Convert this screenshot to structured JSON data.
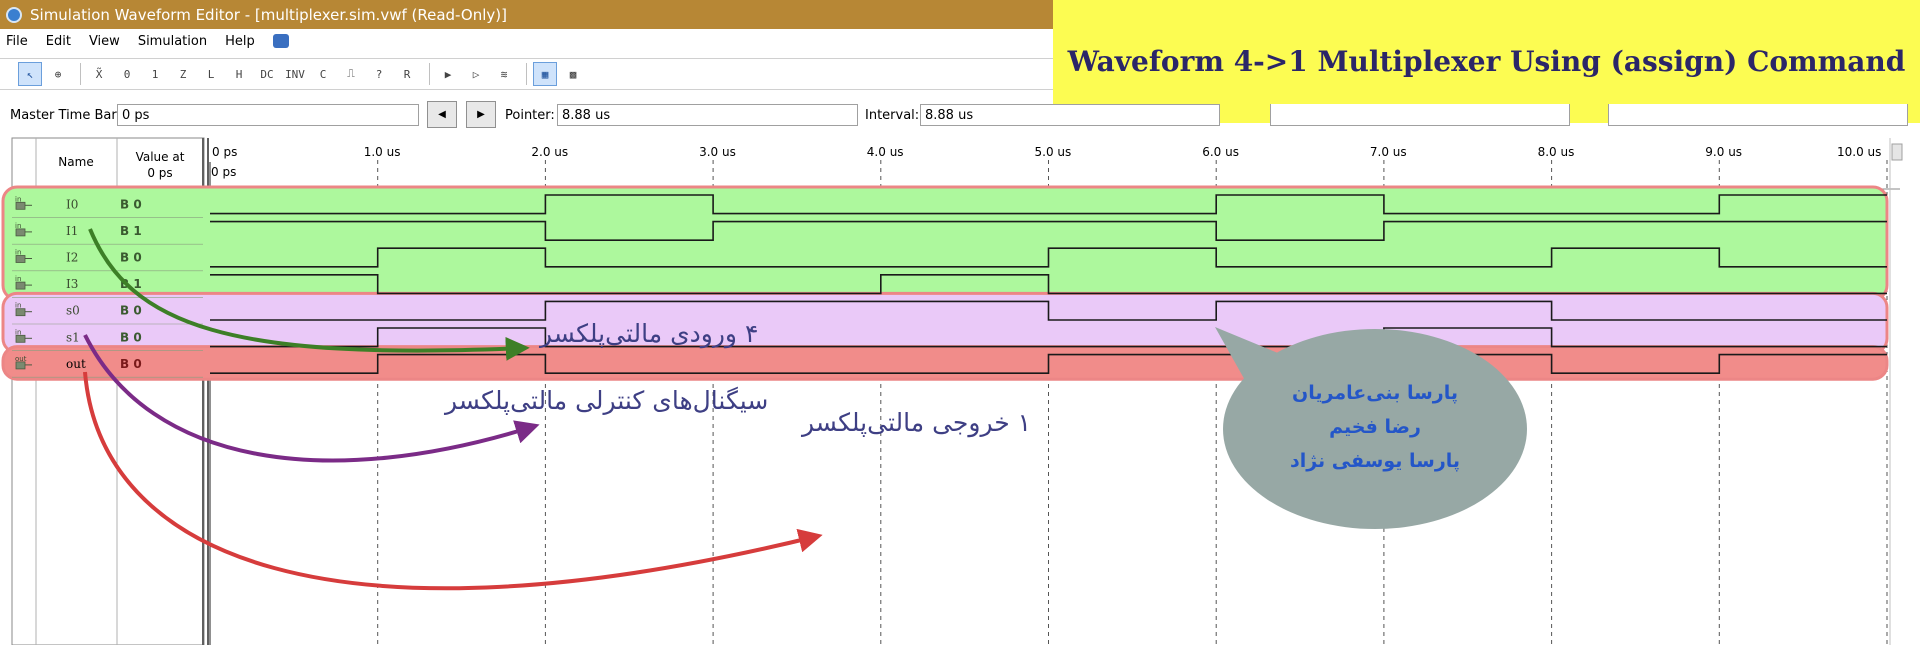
{
  "window": {
    "title": "Simulation Waveform Editor - [multiplexer.sim.vwf (Read-Only)]"
  },
  "banner": {
    "text": "Waveform 4->1 Multiplexer Using (assign) Command"
  },
  "menu": [
    "File",
    "Edit",
    "View",
    "Simulation",
    "Help"
  ],
  "toolbar": {
    "tools": [
      {
        "name": "selection-tool-icon",
        "glyph": "↖",
        "active": true
      },
      {
        "name": "zoom-tool-icon",
        "glyph": "⊕"
      },
      {
        "name": "forcing-unknown-icon",
        "glyph": "X̃"
      },
      {
        "name": "forcing-low-icon",
        "glyph": "0"
      },
      {
        "name": "forcing-high-icon",
        "glyph": "1"
      },
      {
        "name": "high-impedance-icon",
        "glyph": "Z"
      },
      {
        "name": "weak-low-icon",
        "glyph": "L"
      },
      {
        "name": "weak-high-icon",
        "glyph": "H"
      },
      {
        "name": "dont-care-icon",
        "glyph": "DC"
      },
      {
        "name": "invert-icon",
        "glyph": "INV"
      },
      {
        "name": "count-value-icon",
        "glyph": "C"
      },
      {
        "name": "clock-icon",
        "glyph": "⎍"
      },
      {
        "name": "arbitrary-value-icon",
        "glyph": "?"
      },
      {
        "name": "random-value-icon",
        "glyph": "R"
      },
      {
        "name": "functional-sim-icon",
        "glyph": "▶"
      },
      {
        "name": "timing-sim-icon",
        "glyph": "▷"
      },
      {
        "name": "netlist-icon",
        "glyph": "≋"
      },
      {
        "name": "snap-to-grid-icon",
        "glyph": "▦",
        "active": true
      },
      {
        "name": "grid-options-icon",
        "glyph": "▩"
      }
    ]
  },
  "timebar": {
    "master_label": "Master Time Bar:",
    "master_value": "0 ps",
    "pointer_label": "Pointer:",
    "pointer_value": "8.88 us",
    "interval_label": "Interval:",
    "interval_value": "8.88 us",
    "prev_glyph": "◀",
    "next_glyph": "▶"
  },
  "grid": {
    "name_header": "Name",
    "value_header": "Value at\n0 ps",
    "ruler_ticks": [
      "0 ps",
      "1.0 us",
      "2.0 us",
      "3.0 us",
      "4.0 us",
      "5.0 us",
      "6.0 us",
      "7.0 us",
      "8.0 us",
      "9.0 us",
      "10.0 us"
    ],
    "cursor_label": "0 ps",
    "signals": [
      {
        "name": "I0",
        "value": "B 0",
        "kind": "in",
        "group": "inputs",
        "segments": [
          [
            0,
            2,
            0
          ],
          [
            2,
            3,
            1
          ],
          [
            3,
            6,
            0
          ],
          [
            6,
            7,
            1
          ],
          [
            7,
            8,
            0
          ],
          [
            8,
            9,
            0
          ],
          [
            9,
            10,
            1
          ]
        ]
      },
      {
        "name": "I1",
        "value": "B 1",
        "kind": "in",
        "group": "inputs",
        "segments": [
          [
            0,
            2,
            1
          ],
          [
            2,
            3,
            0
          ],
          [
            3,
            5,
            1
          ],
          [
            5,
            6,
            1
          ],
          [
            6,
            7,
            0
          ],
          [
            7,
            8,
            1
          ],
          [
            8,
            9,
            1
          ],
          [
            9,
            10,
            1
          ]
        ]
      },
      {
        "name": "I2",
        "value": "B 0",
        "kind": "in",
        "group": "inputs",
        "segments": [
          [
            0,
            1,
            0
          ],
          [
            1,
            2,
            1
          ],
          [
            2,
            5,
            0
          ],
          [
            5,
            6,
            1
          ],
          [
            6,
            8,
            0
          ],
          [
            8,
            9,
            1
          ],
          [
            9,
            10,
            0
          ]
        ]
      },
      {
        "name": "I3",
        "value": "B 1",
        "kind": "in",
        "group": "inputs",
        "segments": [
          [
            0,
            1,
            1
          ],
          [
            1,
            4,
            0
          ],
          [
            4,
            5,
            1
          ],
          [
            5,
            10,
            0
          ]
        ]
      },
      {
        "name": "s0",
        "value": "B 0",
        "kind": "in",
        "group": "selects",
        "segments": [
          [
            0,
            2,
            0
          ],
          [
            2,
            5,
            1
          ],
          [
            5,
            6,
            0
          ],
          [
            6,
            8,
            1
          ],
          [
            8,
            10,
            0
          ]
        ]
      },
      {
        "name": "s1",
        "value": "B 0",
        "kind": "in",
        "group": "selects",
        "segments": [
          [
            0,
            1,
            0
          ],
          [
            1,
            2,
            1
          ],
          [
            2,
            7,
            0
          ],
          [
            7,
            8,
            1
          ],
          [
            8,
            10,
            0
          ]
        ]
      },
      {
        "name": "out",
        "value": "B 0",
        "kind": "out",
        "group": "output",
        "segments": [
          [
            0,
            1,
            0
          ],
          [
            1,
            2,
            1
          ],
          [
            2,
            5,
            0
          ],
          [
            5,
            8,
            1
          ],
          [
            8,
            9,
            0
          ],
          [
            9,
            10,
            1
          ]
        ]
      }
    ]
  },
  "annotations": {
    "inputs_label": "۴ ورودی مالتی‌پلکسر",
    "selects_label": "سیگنال‌های کنترلی مالتی‌پلکسر",
    "output_label": "۱ خروجی مالتی‌پلکسر",
    "authors": [
      "پارسا بنی‌عامریان",
      "رضا فخیم",
      "پارسا یوسفی نژاد"
    ]
  },
  "colors": {
    "titlebar": "#b78735",
    "banner": "#fcfc52",
    "banner_text": "#2b2668",
    "inputs_fill": "#adf89d",
    "inputs_stroke": "#ec8686",
    "selects_fill": "#eac9f8",
    "selects_stroke": "#ec8686",
    "output_fill": "#f18c8a",
    "output_stroke": "#ec8686",
    "arrow_green": "#3d7f27",
    "arrow_purple": "#7b2b87",
    "arrow_red": "#d63c3c",
    "bubble": "#97a8a5",
    "bubble_text": "#2456c8",
    "anno_text": "#3e3f84"
  }
}
